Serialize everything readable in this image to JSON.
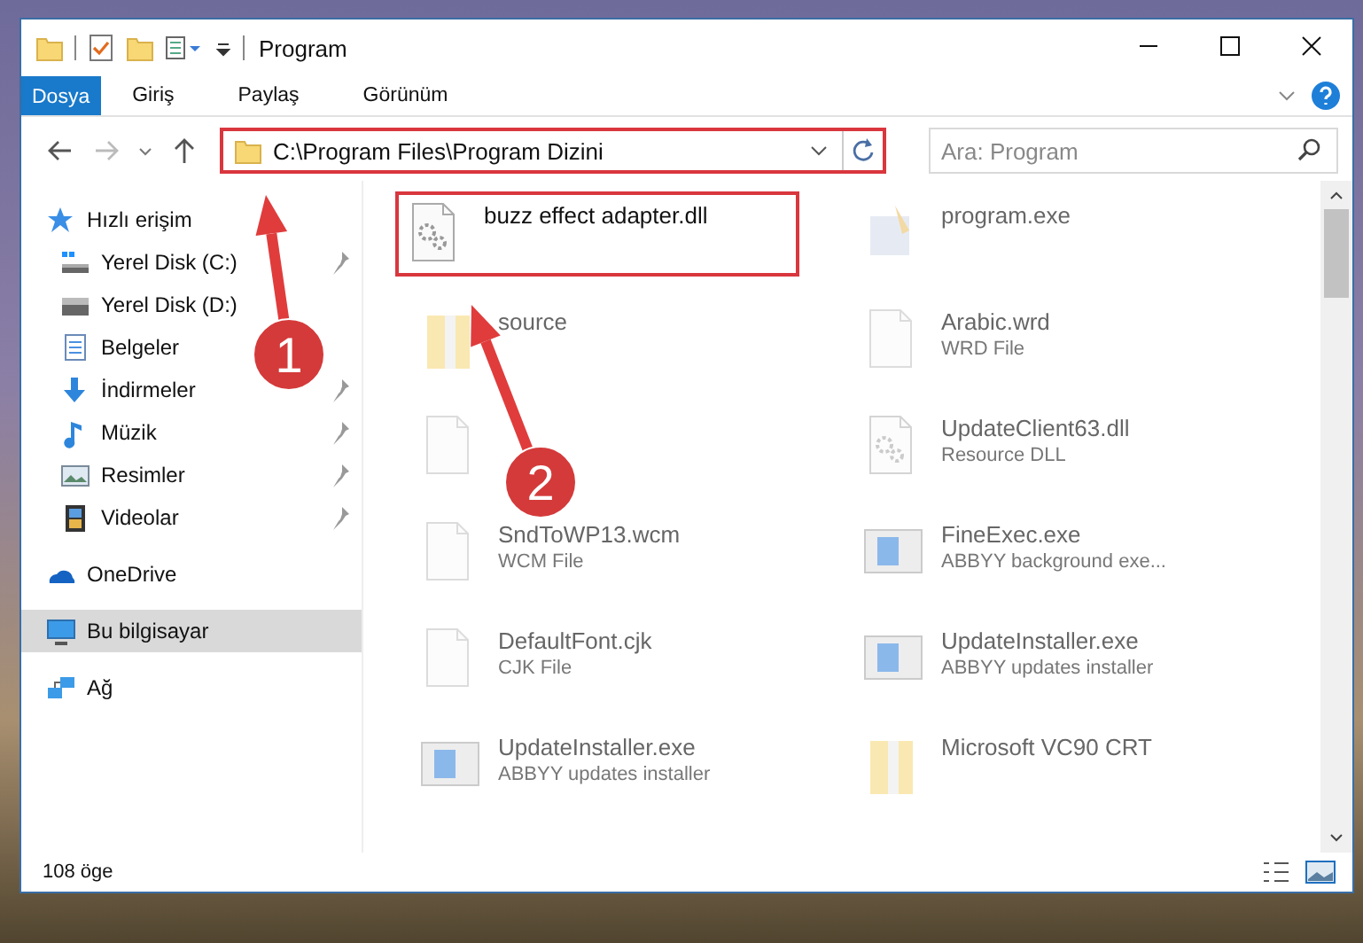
{
  "window": {
    "title": "Program"
  },
  "ribbon_tabs": [
    {
      "label": "Dosya",
      "kind": "file"
    },
    {
      "label": "Giriş",
      "kind": "tab"
    },
    {
      "label": "Paylaş",
      "kind": "tab"
    },
    {
      "label": "Görünüm",
      "kind": "tab"
    }
  ],
  "address_bar": {
    "value": "C:\\Program Files\\Program Dizini",
    "highlighted": true
  },
  "search": {
    "placeholder": "Ara: Program"
  },
  "sidebar": {
    "items": [
      {
        "label": "Hızlı erişim",
        "kind": "star",
        "selected": false,
        "children": [
          {
            "label": "Yerel Disk (C:)",
            "kind": "drive-system",
            "pinned": true
          },
          {
            "label": "Yerel Disk (D:)",
            "kind": "drive",
            "pinned": false
          },
          {
            "label": "Belgeler",
            "kind": "documents",
            "pinned": false
          },
          {
            "label": "İndirmeler",
            "kind": "downloads",
            "pinned": true
          },
          {
            "label": "Müzik",
            "kind": "music",
            "pinned": true
          },
          {
            "label": "Resimler",
            "kind": "pictures",
            "pinned": true
          },
          {
            "label": "Videolar",
            "kind": "videos",
            "pinned": true
          }
        ]
      },
      {
        "label": "OneDrive",
        "kind": "cloud",
        "selected": false
      },
      {
        "label": "Bu bilgisayar",
        "kind": "computer",
        "selected": true
      },
      {
        "label": "Ağ",
        "kind": "network",
        "selected": false
      }
    ]
  },
  "files": [
    {
      "name": "buzz effect adapter.dll",
      "kind": "gear",
      "highlighted": true,
      "faded": false
    },
    {
      "name": "program.exe",
      "kind": "app",
      "highlighted": false,
      "faded": true
    },
    {
      "name": "source",
      "kind": "zip",
      "highlighted": false,
      "faded": true
    },
    {
      "name": "Arabic.wrd",
      "type": "WRD File",
      "kind": "blank",
      "highlighted": false,
      "faded": true
    },
    {
      "kind": "blank",
      "highlighted": false,
      "faded": true
    },
    {
      "name": "UpdateClient63.dll",
      "type": "Resource DLL",
      "kind": "gear",
      "highlighted": false,
      "faded": true
    },
    {
      "name": "SndToWP13.wcm",
      "type": "WCM File",
      "kind": "blank",
      "highlighted": false,
      "faded": true
    },
    {
      "name": "FineExec.exe",
      "type": "ABBYY background exe...",
      "kind": "window",
      "highlighted": false,
      "faded": true
    },
    {
      "name": "DefaultFont.cjk",
      "type": "CJK File",
      "kind": "blank",
      "highlighted": false,
      "faded": true
    },
    {
      "name": "UpdateInstaller.exe",
      "type": "ABBYY updates installer",
      "kind": "window",
      "highlighted": false,
      "faded": true
    },
    {
      "name": "UpdateInstaller.exe",
      "type": "ABBYY updates installer",
      "kind": "window",
      "highlighted": false,
      "faded": true
    },
    {
      "name": "Microsoft VC90 CRT",
      "kind": "zip",
      "highlighted": false,
      "faded": true
    }
  ],
  "annotations": [
    {
      "label": "1"
    },
    {
      "label": "2"
    }
  ],
  "status_bar": {
    "count": "108 öge"
  }
}
